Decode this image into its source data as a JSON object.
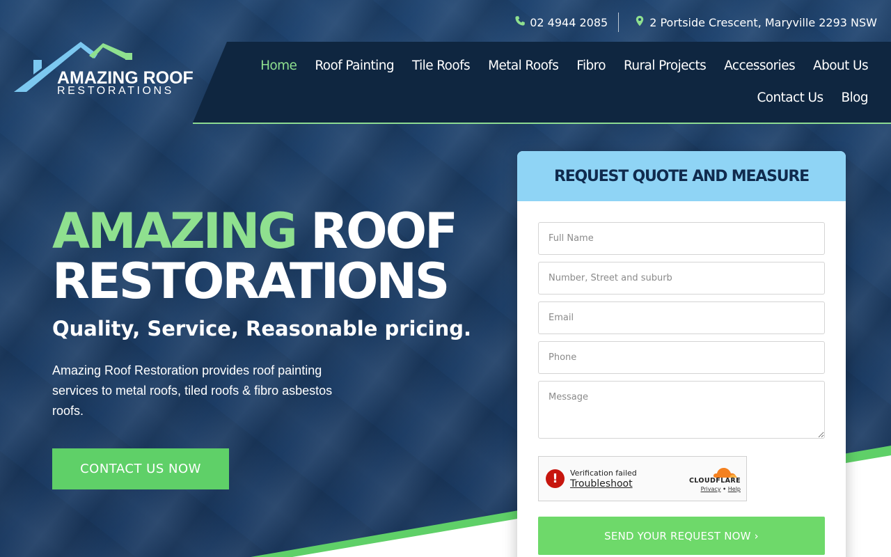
{
  "topbar": {
    "phone": "02 4944 2085",
    "address": "2 Portside Crescent, Maryville 2293 NSW"
  },
  "logo": {
    "line1": "AMAZING ROOF",
    "line2": "RESTORATIONS"
  },
  "nav": {
    "items": [
      {
        "label": "Home",
        "active": true
      },
      {
        "label": "Roof Painting"
      },
      {
        "label": "Tile Roofs"
      },
      {
        "label": "Metal Roofs"
      },
      {
        "label": "Fibro"
      },
      {
        "label": "Rural Projects"
      },
      {
        "label": "Accessories"
      },
      {
        "label": "About Us"
      },
      {
        "label": "Contact Us"
      },
      {
        "label": "Blog"
      }
    ]
  },
  "hero": {
    "title_green": "AMAZING",
    "title_white": " ROOF",
    "title_line2": "RESTORATIONS",
    "subtitle": "Quality, Service, Reasonable pricing.",
    "description": "Amazing Roof Restoration provides roof painting services to metal roofs, tiled roofs & fibro asbestos roofs.",
    "cta_label": "CONTACT US NOW"
  },
  "form": {
    "title": "REQUEST QUOTE AND MEASURE",
    "fields": {
      "name": {
        "placeholder": "Full Name",
        "value": ""
      },
      "address": {
        "placeholder": "Number, Street and suburb",
        "value": ""
      },
      "email": {
        "placeholder": "Email",
        "value": ""
      },
      "phone": {
        "placeholder": "Phone",
        "value": ""
      },
      "message": {
        "placeholder": "Message",
        "value": ""
      }
    },
    "captcha": {
      "status": "Verification failed",
      "action": "Troubleshoot",
      "brand": "CLOUDFLARE",
      "privacy": "Privacy",
      "separator": "•",
      "help": "Help"
    },
    "submit_label": "SEND YOUR REQUEST NOW ›"
  },
  "colors": {
    "accent_green": "#8fe08f",
    "button_green": "#5fd068",
    "nav_bg": "#0f2640",
    "form_header": "#8fd4f5",
    "title_navy": "#102b4e",
    "error_red": "#c7160e",
    "cloudflare_orange": "#f48120"
  },
  "icons": [
    "phone-icon",
    "map-pin-icon",
    "roof-logo-icon",
    "error-icon",
    "cloudflare-icon"
  ]
}
